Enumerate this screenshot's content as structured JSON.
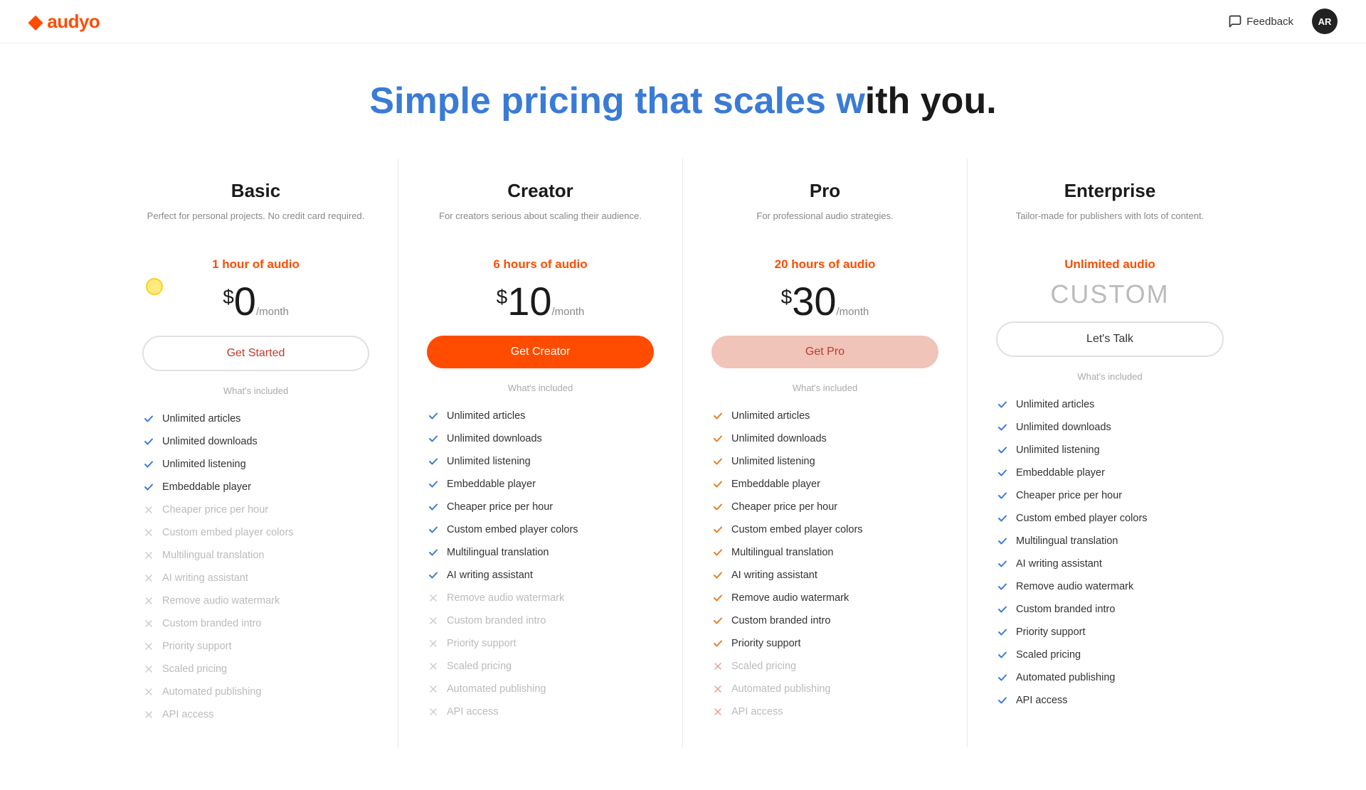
{
  "header": {
    "logo_prefix": "audyo",
    "feedback_label": "Feedback",
    "avatar_initials": "AR"
  },
  "page": {
    "title_highlight": "Simple pricing that scales w",
    "title_normal": "ith you."
  },
  "plans": [
    {
      "id": "basic",
      "name": "Basic",
      "desc": "Perfect for personal projects. No credit card required.",
      "audio": "1 hour of audio",
      "currency": "$",
      "amount": "0",
      "period": "/month",
      "btn_label": "Get Started",
      "btn_class": "btn-basic",
      "whats_included": "What's included",
      "features": [
        {
          "label": "Unlimited articles",
          "enabled": true,
          "check_type": "blue"
        },
        {
          "label": "Unlimited downloads",
          "enabled": true,
          "check_type": "blue"
        },
        {
          "label": "Unlimited listening",
          "enabled": true,
          "check_type": "blue"
        },
        {
          "label": "Embeddable player",
          "enabled": true,
          "check_type": "blue"
        },
        {
          "label": "Cheaper price per hour",
          "enabled": false
        },
        {
          "label": "Custom embed player colors",
          "enabled": false
        },
        {
          "label": "Multilingual translation",
          "enabled": false
        },
        {
          "label": "AI writing assistant",
          "enabled": false
        },
        {
          "label": "Remove audio watermark",
          "enabled": false
        },
        {
          "label": "Custom branded intro",
          "enabled": false
        },
        {
          "label": "Priority support",
          "enabled": false
        },
        {
          "label": "Scaled pricing",
          "enabled": false
        },
        {
          "label": "Automated publishing",
          "enabled": false
        },
        {
          "label": "API access",
          "enabled": false
        }
      ]
    },
    {
      "id": "creator",
      "name": "Creator",
      "desc": "For creators serious about scaling their audience.",
      "audio": "6 hours of audio",
      "currency": "$",
      "amount": "10",
      "period": "/month",
      "btn_label": "Get Creator",
      "btn_class": "btn-creator",
      "whats_included": "What's included",
      "features": [
        {
          "label": "Unlimited articles",
          "enabled": true,
          "check_type": "blue"
        },
        {
          "label": "Unlimited downloads",
          "enabled": true,
          "check_type": "blue"
        },
        {
          "label": "Unlimited listening",
          "enabled": true,
          "check_type": "blue"
        },
        {
          "label": "Embeddable player",
          "enabled": true,
          "check_type": "blue"
        },
        {
          "label": "Cheaper price per hour",
          "enabled": true,
          "check_type": "blue"
        },
        {
          "label": "Custom embed player colors",
          "enabled": true,
          "check_type": "blue"
        },
        {
          "label": "Multilingual translation",
          "enabled": true,
          "check_type": "blue"
        },
        {
          "label": "AI writing assistant",
          "enabled": true,
          "check_type": "blue"
        },
        {
          "label": "Remove audio watermark",
          "enabled": false
        },
        {
          "label": "Custom branded intro",
          "enabled": false
        },
        {
          "label": "Priority support",
          "enabled": false
        },
        {
          "label": "Scaled pricing",
          "enabled": false
        },
        {
          "label": "Automated publishing",
          "enabled": false
        },
        {
          "label": "API access",
          "enabled": false
        }
      ]
    },
    {
      "id": "pro",
      "name": "Pro",
      "desc": "For professional audio strategies.",
      "audio": "20 hours of audio",
      "currency": "$",
      "amount": "30",
      "period": "/month",
      "btn_label": "Get Pro",
      "btn_class": "btn-pro",
      "whats_included": "What's included",
      "features": [
        {
          "label": "Unlimited articles",
          "enabled": true,
          "check_type": "orange"
        },
        {
          "label": "Unlimited downloads",
          "enabled": true,
          "check_type": "orange"
        },
        {
          "label": "Unlimited listening",
          "enabled": true,
          "check_type": "orange"
        },
        {
          "label": "Embeddable player",
          "enabled": true,
          "check_type": "orange"
        },
        {
          "label": "Cheaper price per hour",
          "enabled": true,
          "check_type": "orange"
        },
        {
          "label": "Custom embed player colors",
          "enabled": true,
          "check_type": "orange"
        },
        {
          "label": "Multilingual translation",
          "enabled": true,
          "check_type": "orange"
        },
        {
          "label": "AI writing assistant",
          "enabled": true,
          "check_type": "orange"
        },
        {
          "label": "Remove audio watermark",
          "enabled": true,
          "check_type": "orange"
        },
        {
          "label": "Custom branded intro",
          "enabled": true,
          "check_type": "orange"
        },
        {
          "label": "Priority support",
          "enabled": true,
          "check_type": "orange"
        },
        {
          "label": "Scaled pricing",
          "enabled": false,
          "cross_red": true
        },
        {
          "label": "Automated publishing",
          "enabled": false,
          "cross_red": true
        },
        {
          "label": "API access",
          "enabled": false,
          "cross_red": true
        }
      ]
    },
    {
      "id": "enterprise",
      "name": "Enterprise",
      "desc": "Tailor-made for publishers with lots of content.",
      "audio": "Unlimited audio",
      "currency": "",
      "amount": "CUSTOM",
      "period": "",
      "btn_label": "Let's Talk",
      "btn_class": "btn-enterprise",
      "whats_included": "What's included",
      "features": [
        {
          "label": "Unlimited articles",
          "enabled": true,
          "check_type": "blue"
        },
        {
          "label": "Unlimited downloads",
          "enabled": true,
          "check_type": "blue"
        },
        {
          "label": "Unlimited listening",
          "enabled": true,
          "check_type": "blue"
        },
        {
          "label": "Embeddable player",
          "enabled": true,
          "check_type": "blue"
        },
        {
          "label": "Cheaper price per hour",
          "enabled": true,
          "check_type": "blue"
        },
        {
          "label": "Custom embed player colors",
          "enabled": true,
          "check_type": "blue"
        },
        {
          "label": "Multilingual translation",
          "enabled": true,
          "check_type": "blue"
        },
        {
          "label": "AI writing assistant",
          "enabled": true,
          "check_type": "blue"
        },
        {
          "label": "Remove audio watermark",
          "enabled": true,
          "check_type": "blue"
        },
        {
          "label": "Custom branded intro",
          "enabled": true,
          "check_type": "blue"
        },
        {
          "label": "Priority support",
          "enabled": true,
          "check_type": "blue"
        },
        {
          "label": "Scaled pricing",
          "enabled": true,
          "check_type": "blue"
        },
        {
          "label": "Automated publishing",
          "enabled": true,
          "check_type": "blue"
        },
        {
          "label": "API access",
          "enabled": true,
          "check_type": "blue"
        }
      ]
    }
  ]
}
